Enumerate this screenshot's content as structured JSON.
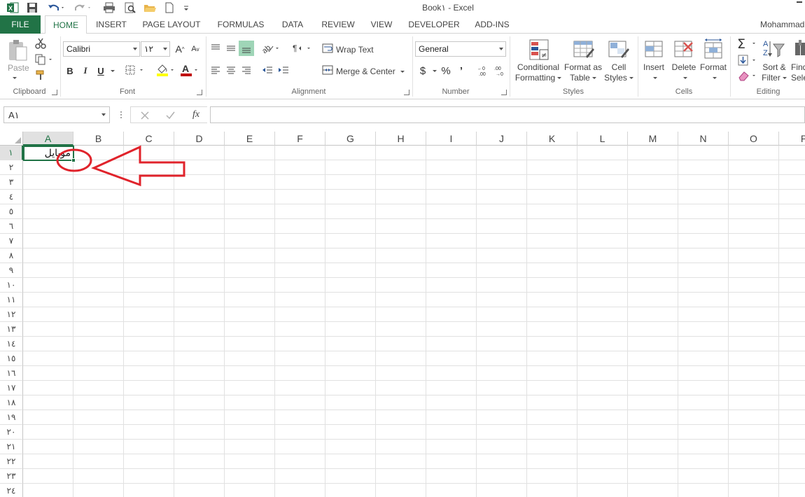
{
  "window": {
    "title": "Book١ - Excel",
    "user": "Mohammad"
  },
  "tabs": [
    "FILE",
    "HOME",
    "INSERT",
    "PAGE LAYOUT",
    "FORMULAS",
    "DATA",
    "REVIEW",
    "VIEW",
    "DEVELOPER",
    "ADD-INS"
  ],
  "active_tab": "HOME",
  "ribbon": {
    "clipboard": {
      "label": "Clipboard",
      "paste": "Paste"
    },
    "font": {
      "label": "Font",
      "name": "Calibri",
      "size": "١٢",
      "bold": "B",
      "italic": "I",
      "underline": "U"
    },
    "alignment": {
      "label": "Alignment",
      "wrap_text": "Wrap Text",
      "merge_center": "Merge & Center"
    },
    "number": {
      "label": "Number",
      "format": "General",
      "currency": "$",
      "percent": "%",
      "comma": "’"
    },
    "styles": {
      "label": "Styles",
      "conditional_1": "Conditional",
      "conditional_2": "Formatting",
      "format_table_1": "Format as",
      "format_table_2": "Table",
      "cell_styles_1": "Cell",
      "cell_styles_2": "Styles"
    },
    "cells": {
      "label": "Cells",
      "insert": "Insert",
      "delete": "Delete",
      "format": "Format"
    },
    "editing": {
      "label": "Editing",
      "sort_1": "Sort &",
      "sort_2": "Filter",
      "find_1": "Find",
      "find_2": "Sele"
    }
  },
  "formula_bar": {
    "name_box": "A١",
    "fx": "fx",
    "value": ""
  },
  "columns": [
    "A",
    "B",
    "C",
    "D",
    "E",
    "F",
    "G",
    "H",
    "I",
    "J",
    "K",
    "L",
    "M",
    "N",
    "O",
    "P"
  ],
  "rows": [
    "١",
    "٢",
    "٣",
    "٤",
    "٥",
    "٦",
    "٧",
    "٨",
    "٩",
    "١٠",
    "١١",
    "١٢",
    "١٣",
    "١٤",
    "١٥",
    "١٦",
    "١٧",
    "١٨",
    "١٩",
    "٢٠",
    "٢١",
    "٢٢",
    "٢٣",
    "٢٤"
  ],
  "selected_cell": {
    "column": "A",
    "row": "١"
  },
  "cell_a1": "موبایل",
  "colors": {
    "excel_green": "#217346",
    "annotation_red": "#e0232b"
  }
}
